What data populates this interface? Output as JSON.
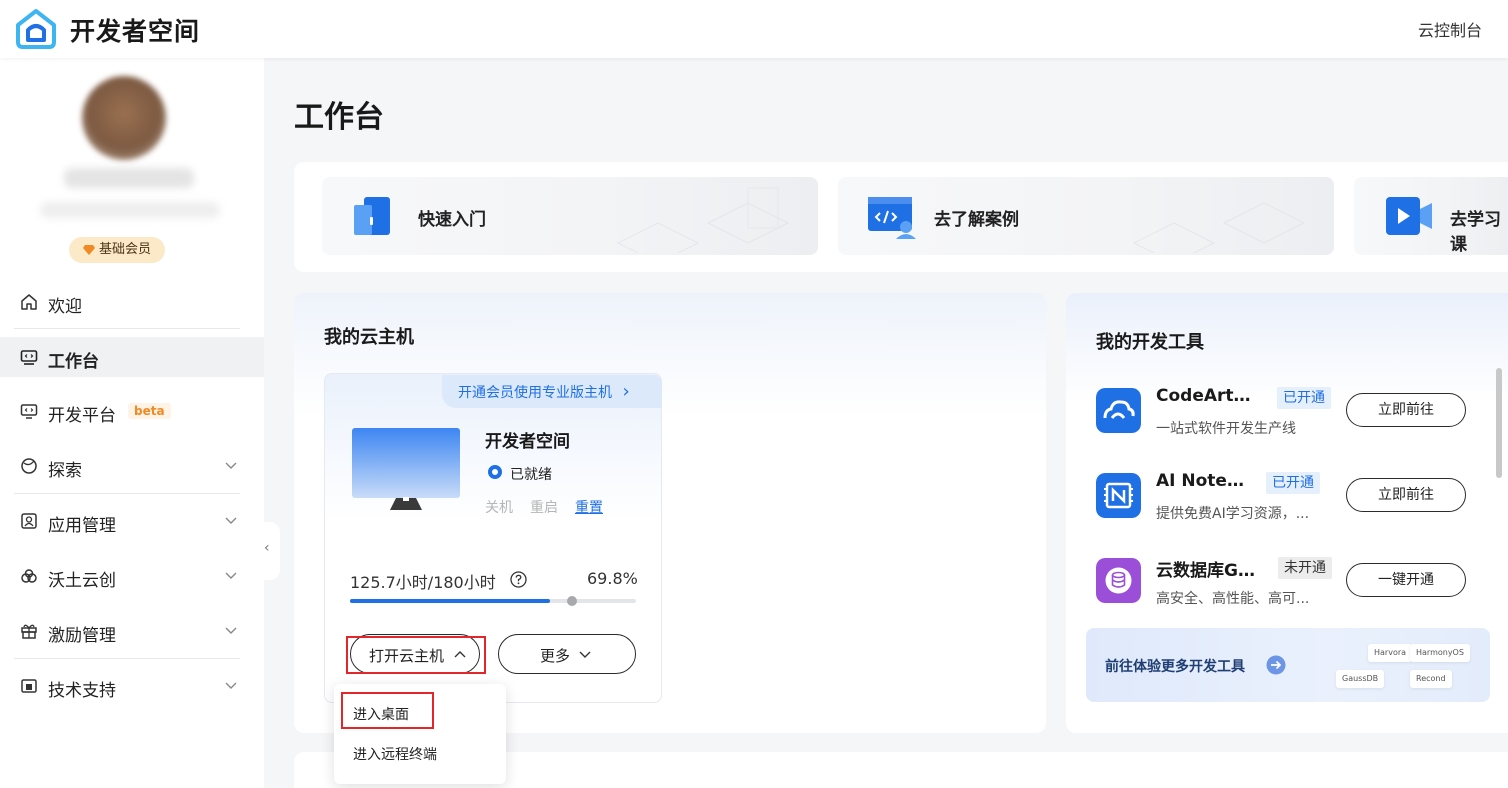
{
  "header": {
    "brand": "开发者空间",
    "console_link": "云控制台"
  },
  "sidebar": {
    "member_badge": "基础会员",
    "items": [
      {
        "label": "欢迎",
        "icon": "home-icon"
      },
      {
        "label": "工作台",
        "icon": "workbench-icon",
        "active": true
      },
      {
        "label": "开发平台",
        "icon": "dev-platform-icon",
        "badge": "beta"
      },
      {
        "label": "探索",
        "icon": "explore-icon"
      },
      {
        "label": "应用管理",
        "icon": "app-manage-icon"
      },
      {
        "label": "沃土云创",
        "icon": "cloud-create-icon"
      },
      {
        "label": "激励管理",
        "icon": "gift-icon"
      },
      {
        "label": "技术支持",
        "icon": "support-icon"
      }
    ],
    "collapse_glyph": "‹"
  },
  "main": {
    "title": "工作台",
    "quick_links": [
      {
        "label": "快速入门",
        "icon": "door-icon"
      },
      {
        "label": "去了解案例",
        "icon": "code-window-icon"
      },
      {
        "label": "去学习课",
        "icon": "video-icon"
      }
    ]
  },
  "cloud_host": {
    "panel_title": "我的云主机",
    "promo": "开通会员使用专业版主机",
    "promo_arrow": "›",
    "name": "开发者空间",
    "status": "已就绪",
    "actions": [
      "关机",
      "重启",
      "重置"
    ],
    "usage_text": "125.7小时/180小时",
    "usage_percent_text": "69.8%",
    "usage_fraction": 0.698,
    "open_button": "打开云主机",
    "more_button": "更多",
    "dropdown": [
      "进入桌面",
      "进入远程终端"
    ],
    "accent_color": "#1f6fe5",
    "highlight_color": "#e4262b"
  },
  "dev_tools": {
    "panel_title": "我的开发工具",
    "items": [
      {
        "name": "CodeArts...",
        "badge": "已开通",
        "status": "on",
        "desc": "一站式软件开发生产线",
        "button": "立即前往",
        "icon": "codearts-icon",
        "color": "#1f6fe5"
      },
      {
        "name": "AI Notebook",
        "badge": "已开通",
        "status": "on",
        "desc": "提供免费AI学习资源，...",
        "button": "立即前往",
        "icon": "notebook-icon",
        "color": "#1f6fe5"
      },
      {
        "name": "云数据库Ga...",
        "badge": "未开通",
        "status": "off",
        "desc": "高安全、高性能、高可...",
        "button": "一键开通",
        "icon": "database-icon",
        "color": "#9b4fd9"
      }
    ],
    "more_link": "前往体验更多开发工具",
    "chips": [
      "Harvora",
      "HarmonyOS",
      "GaussDB",
      "Recond"
    ]
  }
}
